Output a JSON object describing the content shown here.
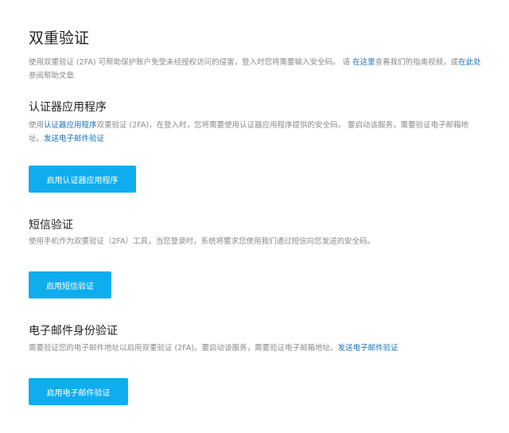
{
  "title": "双重验证",
  "intro": {
    "text1": "使用双重验证 (2FA) 可帮助保护账户免受未经授权访问的侵害，登入时您将需要输入安全码。 请 ",
    "link1": "在这里",
    "text2": "查看我们的指南视频，或",
    "link2": "在此处",
    "text3": "参阅帮助文章"
  },
  "authenticator": {
    "heading": "认证器应用程序",
    "text1": "使用",
    "link1": "认证器应用程序",
    "text2": "双重验证 (2FA)，在登入时，您将需要使用认证器应用程序提供的安全码。 要启动该服务，需要验证电子邮箱地址。",
    "link2": "发送电子邮件验证",
    "button": "启用认证器应用程序"
  },
  "sms": {
    "heading": "短信验证",
    "text": "使用手机作为双重验证（2FA）工具，当您登录时，系统将要求您使用我们通过短信向您发送的安全码。",
    "button": "启用短信验证"
  },
  "email": {
    "heading": "电子邮件身份验证",
    "text": "需要验证您的电子邮件地址以启用双重验证 (2FA)。要启动该服务，需要验证电子邮箱地址。",
    "link": "发送电子邮件验证",
    "button": "启用电子邮件验证"
  },
  "colors": {
    "accent": "#0fadee",
    "link": "#1a6fb5"
  }
}
